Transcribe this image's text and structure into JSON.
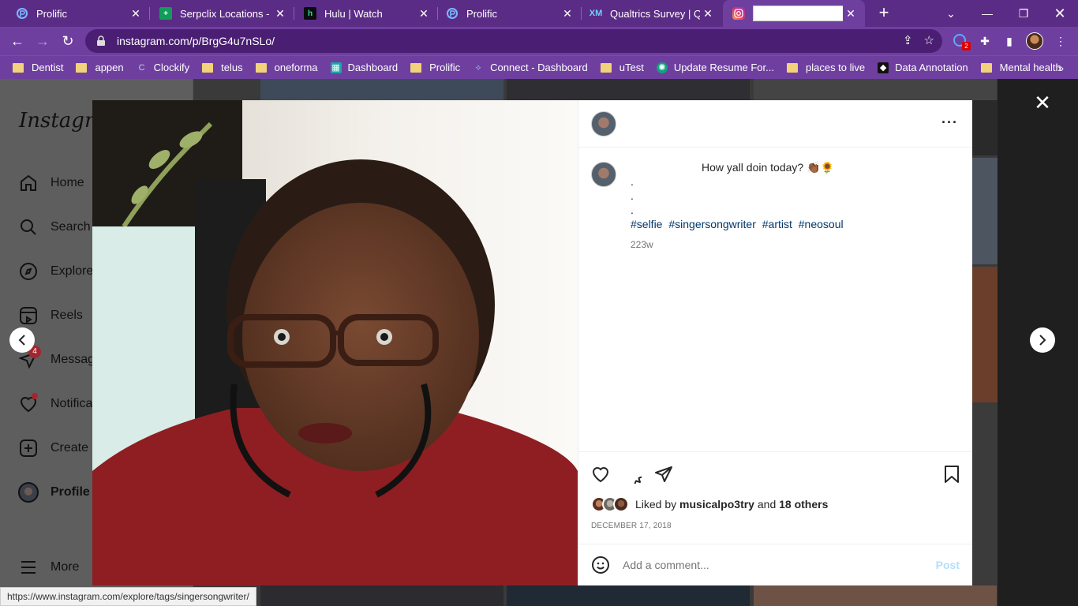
{
  "browser": {
    "tabs": [
      {
        "title": "Prolific",
        "icon": "prolific-icon",
        "color": "#2f6dff"
      },
      {
        "title": "Serpclix Locations - Go",
        "icon": "sheets-icon",
        "color": "#0f9d58"
      },
      {
        "title": "Hulu | Watch",
        "icon": "hulu-icon",
        "color": "#1ce783"
      },
      {
        "title": "Prolific",
        "icon": "prolific-icon",
        "color": "#2f6dff"
      },
      {
        "title": "Qualtrics Survey | Qua",
        "icon": "qualtrics-icon",
        "color": "#21dbaa"
      },
      {
        "title": "",
        "icon": "instagram-icon",
        "color": "#e1306c"
      }
    ],
    "url": "instagram.com/p/BrgG4u7nSLo/",
    "extension_badge": "2",
    "bookmarks": [
      {
        "label": "Dentist",
        "type": "folder"
      },
      {
        "label": "appen",
        "type": "folder"
      },
      {
        "label": "Clockify",
        "type": "site"
      },
      {
        "label": "telus",
        "type": "folder"
      },
      {
        "label": "oneforma",
        "type": "folder"
      },
      {
        "label": "Dashboard",
        "type": "site"
      },
      {
        "label": "Prolific",
        "type": "folder"
      },
      {
        "label": "Connect - Dashboard",
        "type": "site"
      },
      {
        "label": "uTest",
        "type": "folder"
      },
      {
        "label": "Update Resume For...",
        "type": "site"
      },
      {
        "label": "places to live",
        "type": "folder"
      },
      {
        "label": "Data Annotation",
        "type": "site"
      },
      {
        "label": "Mental health",
        "type": "folder"
      }
    ],
    "status_url": "https://www.instagram.com/explore/tags/singersongwriter/"
  },
  "sidebar": {
    "logo": "Instagram",
    "messages_badge": "4",
    "items": [
      {
        "label": "Home"
      },
      {
        "label": "Search"
      },
      {
        "label": "Explore"
      },
      {
        "label": "Reels"
      },
      {
        "label": "Messages"
      },
      {
        "label": "Notifications"
      },
      {
        "label": "Create"
      },
      {
        "label": "Profile"
      },
      {
        "label": "More"
      }
    ]
  },
  "post": {
    "caption_line1": "How yall doin today? 👏🏾🌻",
    "caption_dots": [
      ".",
      ".",
      "."
    ],
    "hashtags": [
      "#selfie",
      "#singersongwriter",
      "#artist",
      "#neosoul"
    ],
    "time_ago": "223w",
    "liked_by_prefix": "Liked by",
    "liked_by_user": "musicalpo3try",
    "liked_by_and": "and",
    "liked_by_others": "18 others",
    "date": "DECEMBER 17, 2018",
    "comment_placeholder": "Add a comment...",
    "post_button": "Post"
  }
}
